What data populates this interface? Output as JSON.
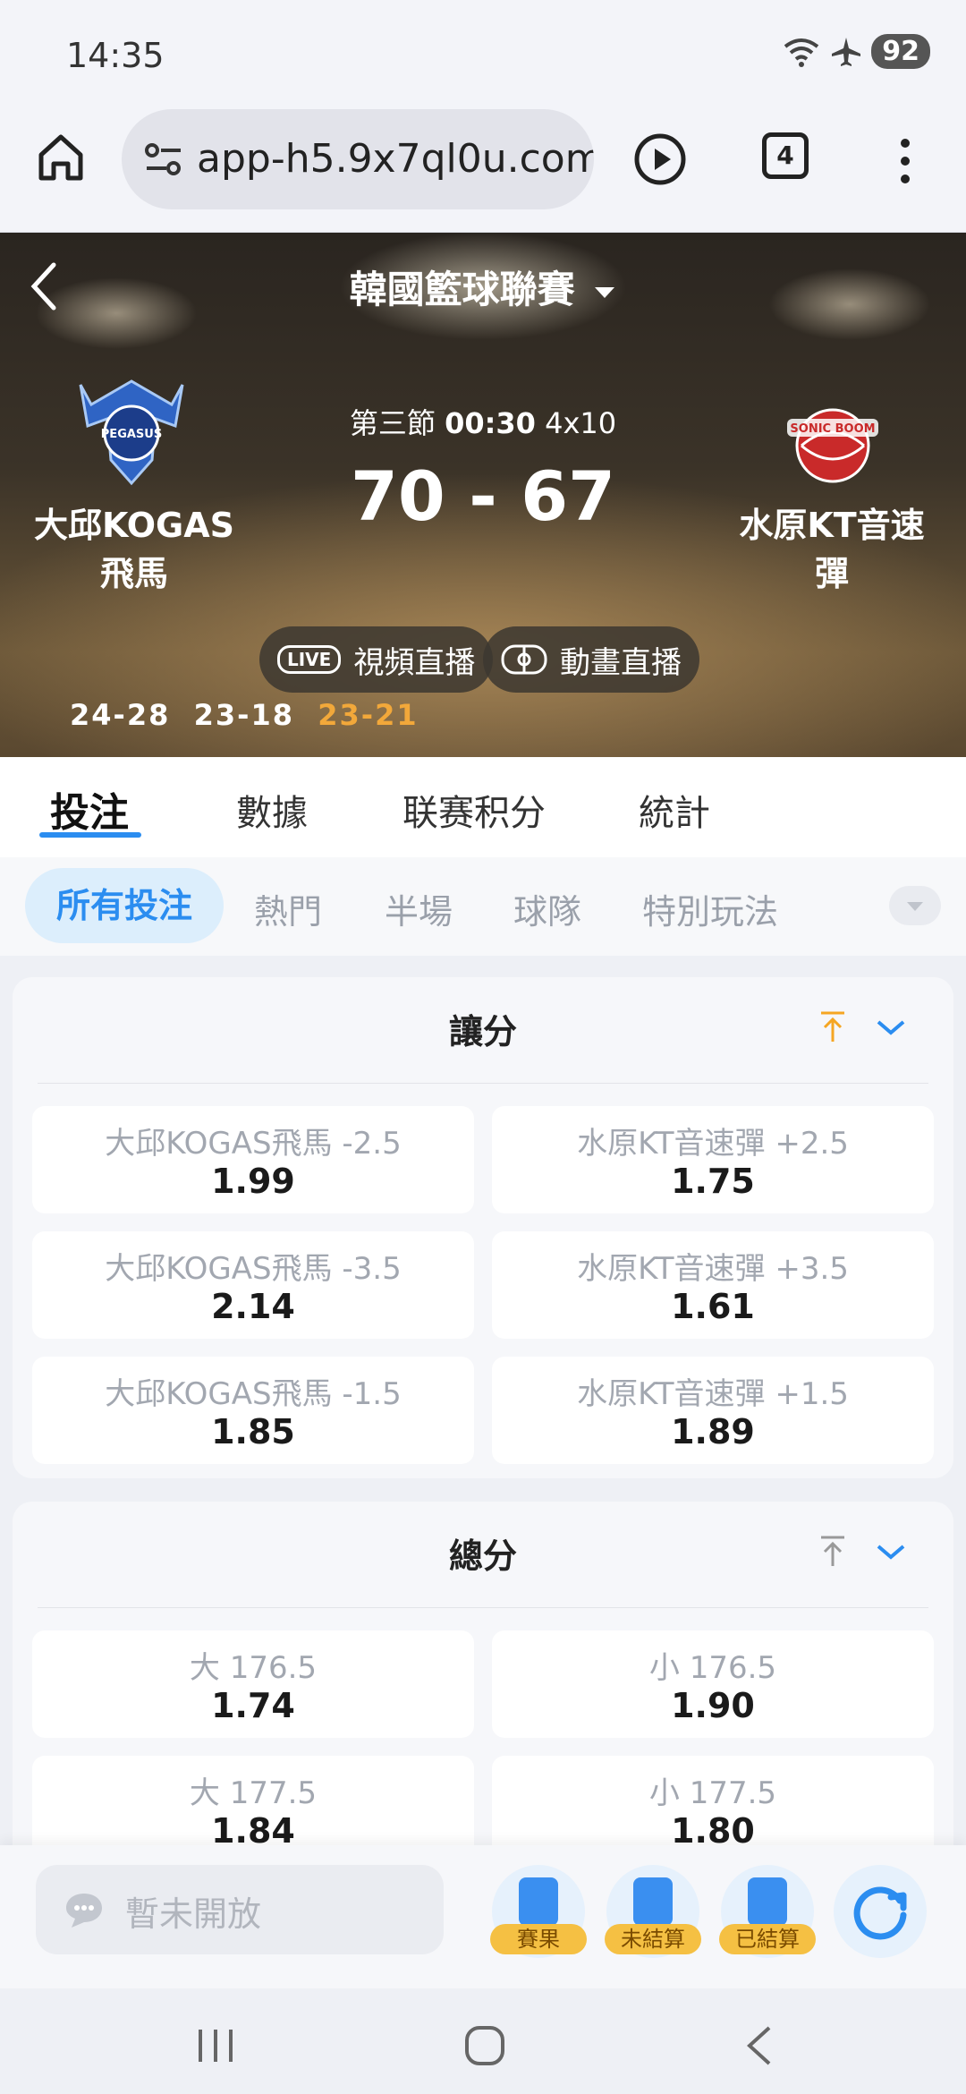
{
  "status_bar": {
    "time": "14:35",
    "battery": "92"
  },
  "browser": {
    "url": "app-h5.9x7ql0u.com",
    "tab_count": "4"
  },
  "match": {
    "league": "韓國籃球聯賽",
    "home": {
      "name_line1": "大邱KOGAS",
      "name_line2": "飛馬",
      "logo_text": "PEGASUS"
    },
    "away": {
      "name_line1": "水原KT音速",
      "name_line2": "彈",
      "logo_text": "SONIC BOOM"
    },
    "period": "第三節",
    "clock": "00:30",
    "format": "4x10",
    "score": "70 - 67",
    "live_video": "視頻直播",
    "live_badge": "LIVE",
    "animation": "動畫直播",
    "quarters": [
      "24-28",
      "23-18",
      "23-21"
    ]
  },
  "tabs": [
    "投注",
    "數據",
    "联赛积分",
    "統計"
  ],
  "filters": [
    "所有投注",
    "熱門",
    "半場",
    "球隊",
    "特別玩法"
  ],
  "markets": [
    {
      "title": "讓分",
      "rows": [
        [
          {
            "label": "大邱KOGAS飛馬 -2.5",
            "odds": "1.99"
          },
          {
            "label": "水原KT音速彈 +2.5",
            "odds": "1.75"
          }
        ],
        [
          {
            "label": "大邱KOGAS飛馬 -3.5",
            "odds": "2.14"
          },
          {
            "label": "水原KT音速彈 +3.5",
            "odds": "1.61"
          }
        ],
        [
          {
            "label": "大邱KOGAS飛馬 -1.5",
            "odds": "1.85"
          },
          {
            "label": "水原KT音速彈 +1.5",
            "odds": "1.89"
          }
        ]
      ]
    },
    {
      "title": "總分",
      "rows": [
        [
          {
            "label": "大 176.5",
            "odds": "1.74"
          },
          {
            "label": "小 176.5",
            "odds": "1.90"
          }
        ],
        [
          {
            "label": "大 177.5",
            "odds": "1.84"
          },
          {
            "label": "小 177.5",
            "odds": "1.80"
          }
        ]
      ]
    }
  ],
  "bottom": {
    "chat_placeholder": "暫未開放",
    "buttons": [
      "賽果",
      "未結算",
      "已結算"
    ]
  },
  "colors": {
    "accent": "#2b8df0",
    "highlight": "#f2a83a",
    "pin_active": "#f5a623"
  }
}
